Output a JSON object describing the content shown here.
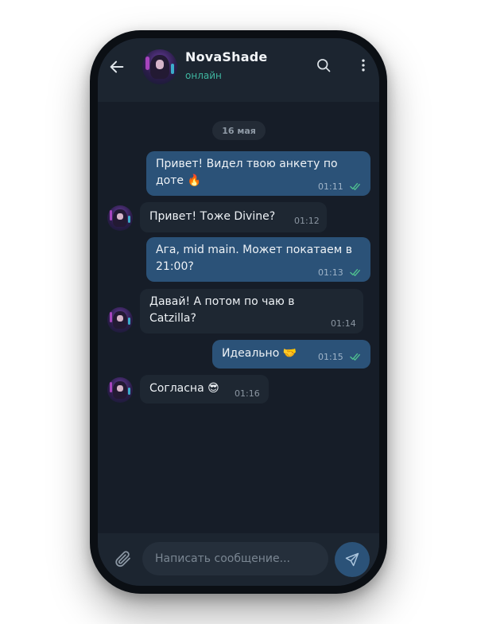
{
  "header": {
    "contact_name": "NovaShade",
    "status": "онлайн",
    "icons": {
      "back": "arrow-left-icon",
      "search": "search-icon",
      "menu": "more-vertical-icon"
    }
  },
  "chat": {
    "date_label": "16 мая",
    "messages": [
      {
        "direction": "out",
        "text": "Привет! Видел твою анкету по доте 🔥",
        "time": "01:11",
        "read": true
      },
      {
        "direction": "in",
        "text": "Привет! Тоже Divine?",
        "time": "01:12"
      },
      {
        "direction": "out",
        "text": "Ага, mid main. Может покатаем в 21:00?",
        "time": "01:13",
        "read": true
      },
      {
        "direction": "in",
        "text": "Давай! А потом по чаю в Catzilla?",
        "time": "01:14"
      },
      {
        "direction": "out",
        "text": "Идеально 🤝",
        "time": "01:15",
        "read": true
      },
      {
        "direction": "in",
        "text": "Согласна 😎",
        "time": "01:16"
      }
    ]
  },
  "composer": {
    "placeholder": "Написать сообщение...",
    "icons": {
      "attach": "paperclip-icon",
      "send": "send-icon"
    }
  },
  "colors": {
    "background": "#161d28",
    "header": "#1c2530",
    "bubble_out": "#2b5278",
    "bubble_in": "#1e2732",
    "status_online": "#3fb6a0",
    "read_check": "#4fbf8f"
  }
}
